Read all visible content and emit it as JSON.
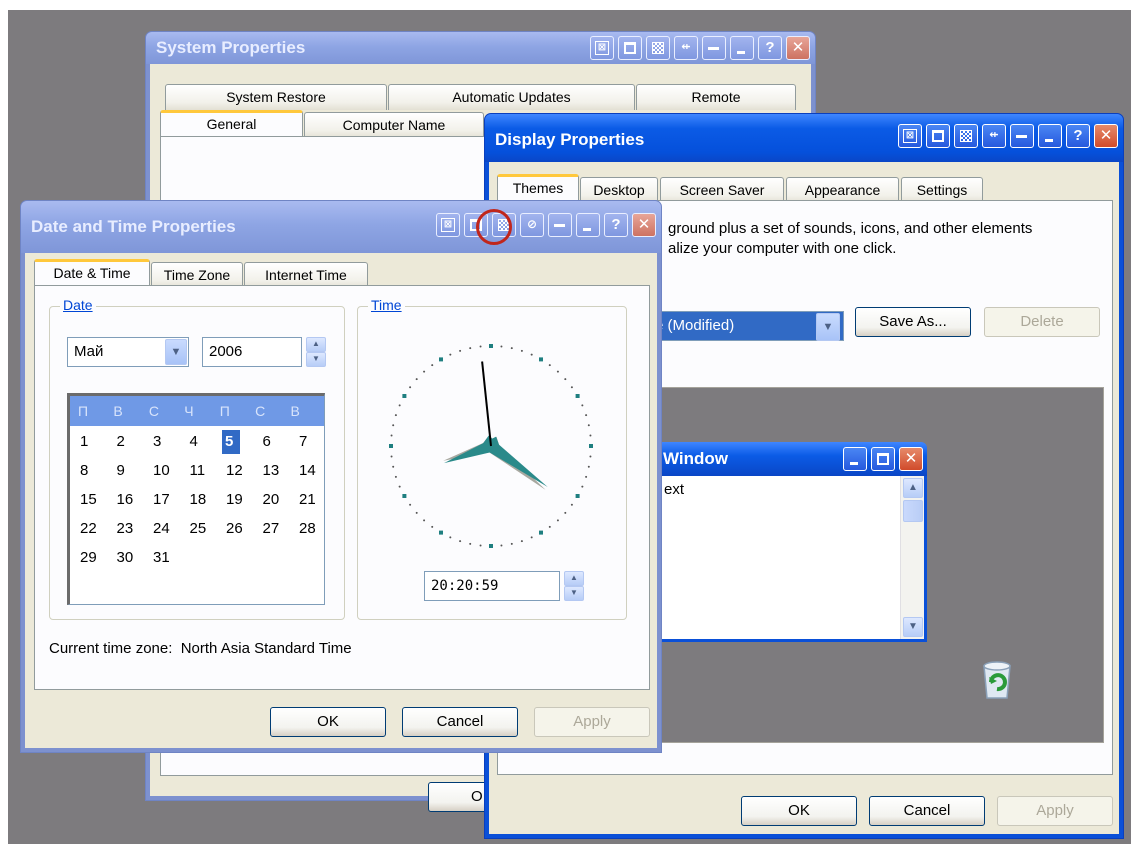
{
  "system_properties": {
    "title": "System Properties",
    "tabs_top": [
      "System Restore",
      "Automatic Updates",
      "Remote"
    ],
    "tabs_bottom": [
      "General",
      "Computer Name"
    ],
    "stub_text": "S",
    "ok_stub": "O"
  },
  "display_properties": {
    "title": "Display Properties",
    "tabs": [
      "Themes",
      "Desktop",
      "Screen Saver",
      "Appearance",
      "Settings"
    ],
    "description_line1": "ground plus a set of sounds, icons, and other elements",
    "description_line2": "alize your computer with one click.",
    "theme_value": "e (Modified)",
    "save_as": "Save As...",
    "delete": "Delete",
    "preview_window_title": "Window",
    "preview_window_text": "ext",
    "ok": "OK",
    "cancel": "Cancel",
    "apply": "Apply"
  },
  "datetime": {
    "title": "Date and Time Properties",
    "tabs": [
      "Date & Time",
      "Time Zone",
      "Internet Time"
    ],
    "date_legend": "Date",
    "time_legend": "Time",
    "month": "Май",
    "year": "2006",
    "weekdays": [
      "П",
      "В",
      "С",
      "Ч",
      "П",
      "С",
      "В"
    ],
    "weeks": [
      [
        "1",
        "2",
        "3",
        "4",
        "5",
        "6",
        "7"
      ],
      [
        "8",
        "9",
        "10",
        "11",
        "12",
        "13",
        "14"
      ],
      [
        "15",
        "16",
        "17",
        "18",
        "19",
        "20",
        "21"
      ],
      [
        "22",
        "23",
        "24",
        "25",
        "26",
        "27",
        "28"
      ],
      [
        "29",
        "30",
        "31"
      ]
    ],
    "selected_day": "5",
    "time_value": "20:20:59",
    "timezone_text": "Current time zone:  North Asia Standard Time",
    "ok": "OK",
    "cancel": "Cancel",
    "apply": "Apply"
  },
  "colors": {
    "highlight_circle": "#c0261c",
    "selected_day_bg": "#316ac5"
  }
}
